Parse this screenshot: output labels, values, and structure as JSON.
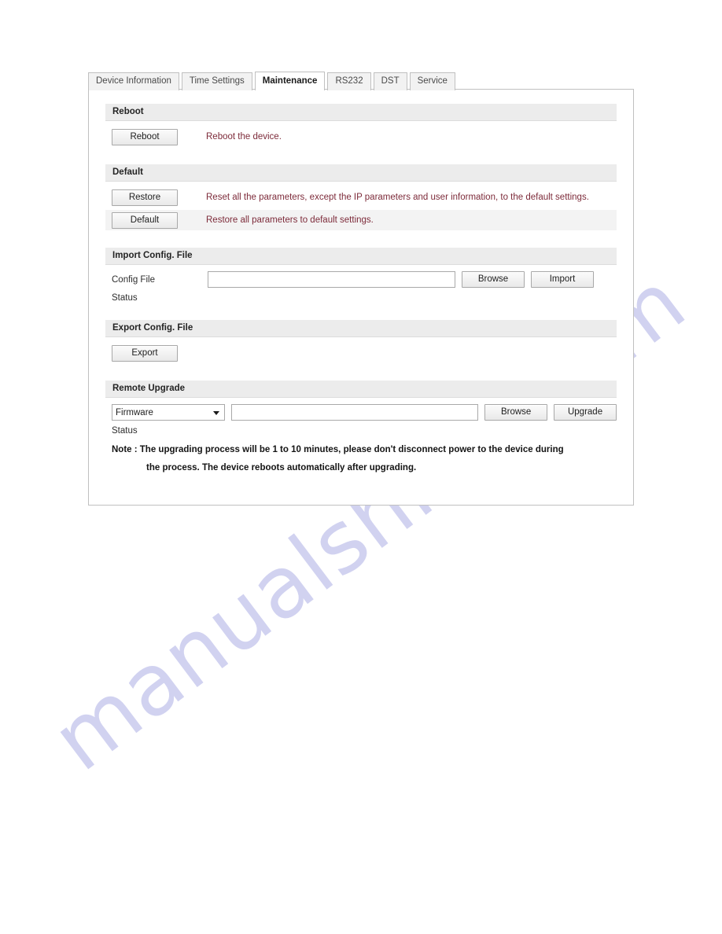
{
  "watermark": {
    "text": "manualshive.com",
    "color": "#c9cbee"
  },
  "tabs": [
    {
      "label": "Device Information",
      "active": false
    },
    {
      "label": "Time Settings",
      "active": false
    },
    {
      "label": "Maintenance",
      "active": true
    },
    {
      "label": "RS232",
      "active": false
    },
    {
      "label": "DST",
      "active": false
    },
    {
      "label": "Service",
      "active": false
    }
  ],
  "sections": {
    "reboot": {
      "title": "Reboot",
      "button": "Reboot",
      "description": "Reboot the device."
    },
    "default": {
      "title": "Default",
      "restore_button": "Restore",
      "restore_description": "Reset all the parameters, except the IP parameters and user information, to the default settings.",
      "default_button": "Default",
      "default_description": "Restore all parameters to default settings."
    },
    "import_config": {
      "title": "Import Config. File",
      "field_label": "Config File",
      "file_value": "",
      "file_placeholder": "",
      "browse_button": "Browse",
      "import_button": "Import",
      "status_label": "Status"
    },
    "export_config": {
      "title": "Export Config. File",
      "export_button": "Export"
    },
    "remote_upgrade": {
      "title": "Remote Upgrade",
      "type_selected": "Firmware",
      "file_value": "",
      "file_placeholder": "",
      "browse_button": "Browse",
      "upgrade_button": "Upgrade",
      "status_label": "Status",
      "note_line_1": "Note :  The upgrading process will be 1 to 10 minutes, please don't disconnect power to the device during",
      "note_line_2": "the process. The device reboots automatically after upgrading."
    }
  },
  "colors": {
    "description_text": "#7d2b3a",
    "section_header_bg": "#ececec",
    "panel_border": "#c0c0c0"
  }
}
